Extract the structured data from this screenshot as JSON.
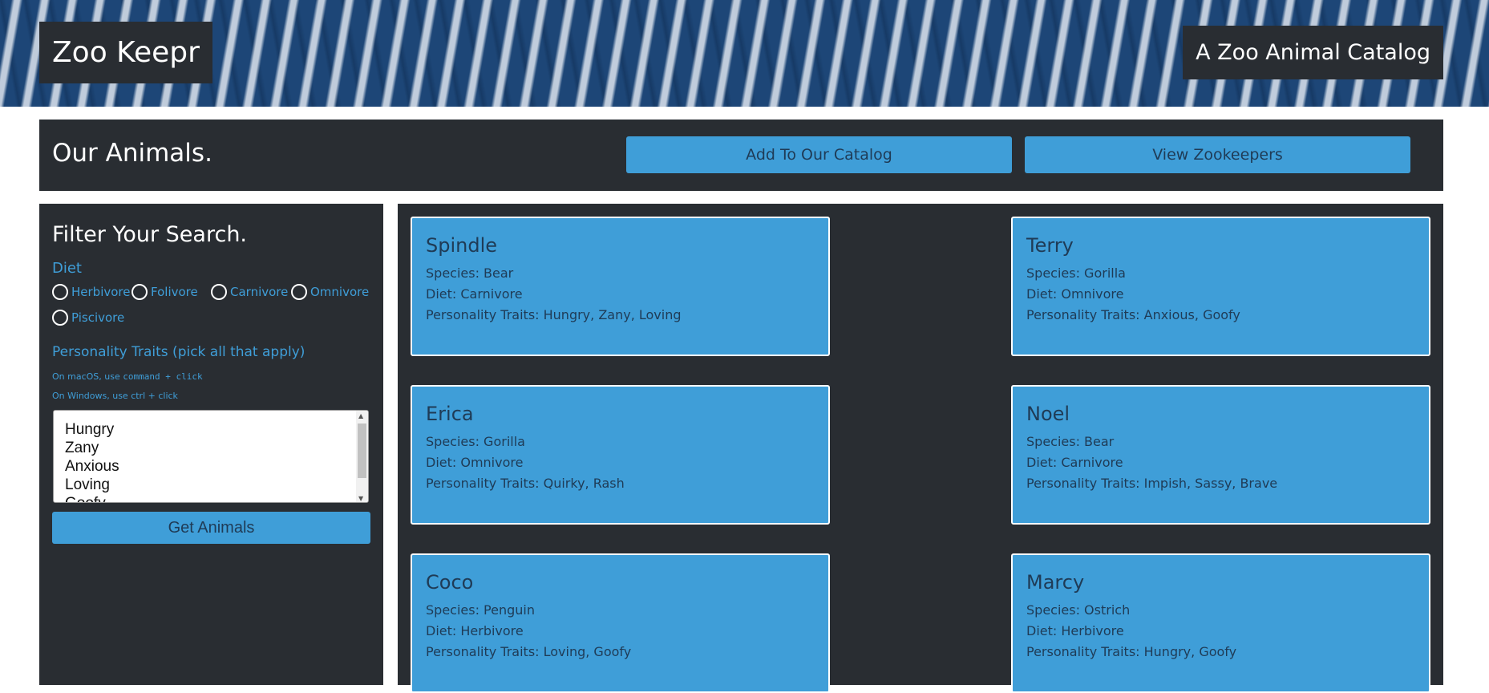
{
  "header": {
    "brand": "Zoo Keepr",
    "tagline": "A Zoo Animal Catalog"
  },
  "section": {
    "title": "Our Animals.",
    "add_button": "Add To Our Catalog",
    "view_button": "View Zookeepers"
  },
  "filter": {
    "title": "Filter Your Search.",
    "diet_label": "Diet",
    "diets": [
      "Herbivore",
      "Folivore",
      "Carnivore",
      "Omnivore",
      "Piscivore"
    ],
    "traits_label": "Personality Traits (pick all that apply)",
    "hint_mac_prefix": "On macOS, use ",
    "hint_mac_code": "command + click",
    "hint_windows": "On Windows, use ctrl + click",
    "traits": [
      "Hungry",
      "Zany",
      "Anxious",
      "Loving",
      "Goofy"
    ],
    "get_button": "Get Animals"
  },
  "animals": [
    {
      "name": "Spindle",
      "species": "Species: Bear",
      "diet": "Diet: Carnivore",
      "traits": "Personality Traits: Hungry, Zany, Loving"
    },
    {
      "name": "Terry",
      "species": "Species: Gorilla",
      "diet": "Diet: Omnivore",
      "traits": "Personality Traits: Anxious, Goofy"
    },
    {
      "name": "Erica",
      "species": "Species: Gorilla",
      "diet": "Diet: Omnivore",
      "traits": "Personality Traits: Quirky, Rash"
    },
    {
      "name": "Noel",
      "species": "Species: Bear",
      "diet": "Diet: Carnivore",
      "traits": "Personality Traits: Impish, Sassy, Brave"
    },
    {
      "name": "Coco",
      "species": "Species: Penguin",
      "diet": "Diet: Herbivore",
      "traits": "Personality Traits: Loving, Goofy"
    },
    {
      "name": "Marcy",
      "species": "Species: Ostrich",
      "diet": "Diet: Herbivore",
      "traits": "Personality Traits: Hungry, Goofy"
    }
  ],
  "colors": {
    "accent": "#3f9ed8",
    "panel": "#292d32",
    "card_text": "#1f3b56",
    "banner": "#1d4677"
  }
}
